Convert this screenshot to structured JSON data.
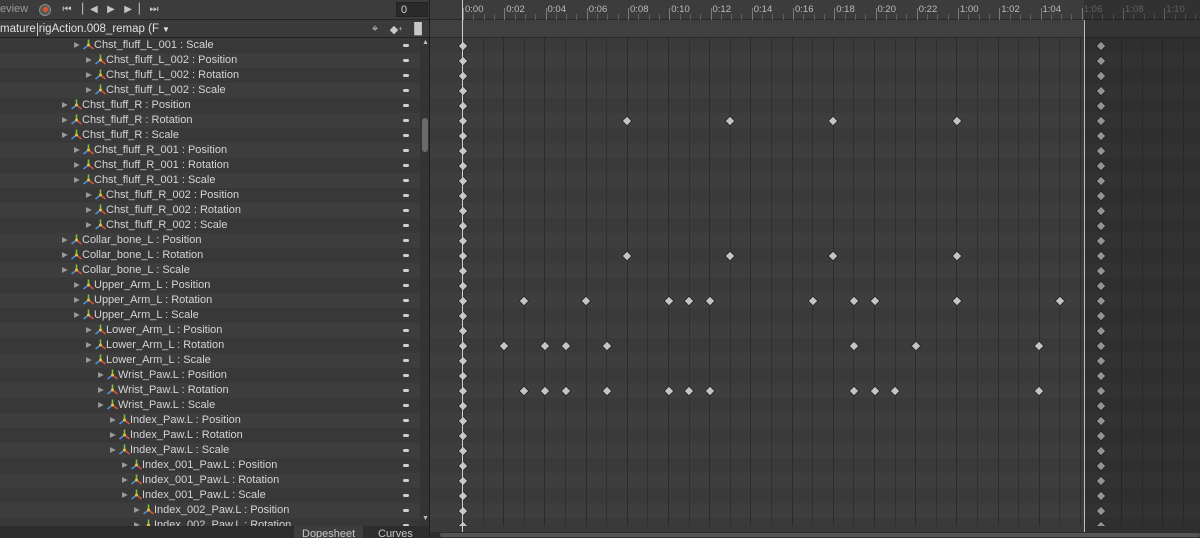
{
  "toolbar": {
    "preview_label": "eview",
    "frame_value": "0"
  },
  "clip": {
    "object_name": "mature",
    "clip_name": "rigAction.008_remap (F"
  },
  "rows": [
    {
      "label": "Chst_fluff_L_001 : Scale",
      "indent": 2
    },
    {
      "label": "Chst_fluff_L_002 : Position",
      "indent": 3
    },
    {
      "label": "Chst_fluff_L_002 : Rotation",
      "indent": 3
    },
    {
      "label": "Chst_fluff_L_002 : Scale",
      "indent": 3
    },
    {
      "label": "Chst_fluff_R : Position",
      "indent": 1
    },
    {
      "label": "Chst_fluff_R : Rotation",
      "indent": 1
    },
    {
      "label": "Chst_fluff_R : Scale",
      "indent": 1
    },
    {
      "label": "Chst_fluff_R_001 : Position",
      "indent": 2
    },
    {
      "label": "Chst_fluff_R_001 : Rotation",
      "indent": 2
    },
    {
      "label": "Chst_fluff_R_001 : Scale",
      "indent": 2
    },
    {
      "label": "Chst_fluff_R_002 : Position",
      "indent": 3
    },
    {
      "label": "Chst_fluff_R_002 : Rotation",
      "indent": 3
    },
    {
      "label": "Chst_fluff_R_002 : Scale",
      "indent": 3
    },
    {
      "label": "Collar_bone_L : Position",
      "indent": 1
    },
    {
      "label": "Collar_bone_L : Rotation",
      "indent": 1
    },
    {
      "label": "Collar_bone_L : Scale",
      "indent": 1
    },
    {
      "label": "Upper_Arm_L : Position",
      "indent": 2
    },
    {
      "label": "Upper_Arm_L : Rotation",
      "indent": 2
    },
    {
      "label": "Upper_Arm_L : Scale",
      "indent": 2
    },
    {
      "label": "Lower_Arm_L : Position",
      "indent": 3
    },
    {
      "label": "Lower_Arm_L : Rotation",
      "indent": 3
    },
    {
      "label": "Lower_Arm_L : Scale",
      "indent": 3
    },
    {
      "label": "Wrist_Paw.L : Position",
      "indent": 4
    },
    {
      "label": "Wrist_Paw.L : Rotation",
      "indent": 4
    },
    {
      "label": "Wrist_Paw.L : Scale",
      "indent": 4
    },
    {
      "label": "Index_Paw.L : Position",
      "indent": 5
    },
    {
      "label": "Index_Paw.L : Rotation",
      "indent": 5
    },
    {
      "label": "Index_Paw.L : Scale",
      "indent": 5
    },
    {
      "label": "Index_001_Paw.L : Position",
      "indent": 6
    },
    {
      "label": "Index_001_Paw.L : Rotation",
      "indent": 6
    },
    {
      "label": "Index_001_Paw.L : Scale",
      "indent": 6
    },
    {
      "label": "Index_002_Paw.L : Position",
      "indent": 7
    },
    {
      "label": "Index_002_Paw.L : Rotation",
      "indent": 7
    }
  ],
  "ruler_labels": [
    "0:00",
    "0:02",
    "0:04",
    "0:06",
    "0:08",
    "0:10",
    "0:12",
    "0:14",
    "0:16",
    "0:18",
    "0:20",
    "0:22",
    "1:00",
    "1:02",
    "1:04",
    "1:06",
    "1:08",
    "1:10"
  ],
  "ruler_dim_from": 15,
  "clip_end_time": 31,
  "keyframes": {
    "5": [
      8,
      13,
      18,
      24
    ],
    "14": [
      8,
      13,
      18,
      24
    ],
    "17": [
      3,
      6,
      10,
      11,
      12,
      17,
      19,
      20,
      24,
      29
    ],
    "20": [
      2,
      4,
      5,
      7,
      19,
      22,
      28
    ],
    "23": [
      3,
      4,
      5,
      7,
      10,
      11,
      12,
      19,
      20,
      21,
      28
    ]
  },
  "tabs": {
    "dopesheet": "Dopesheet",
    "curves": "Curves"
  },
  "colors": {
    "accent_record": "#e0552e",
    "keyframe": "#c4c4c4"
  }
}
